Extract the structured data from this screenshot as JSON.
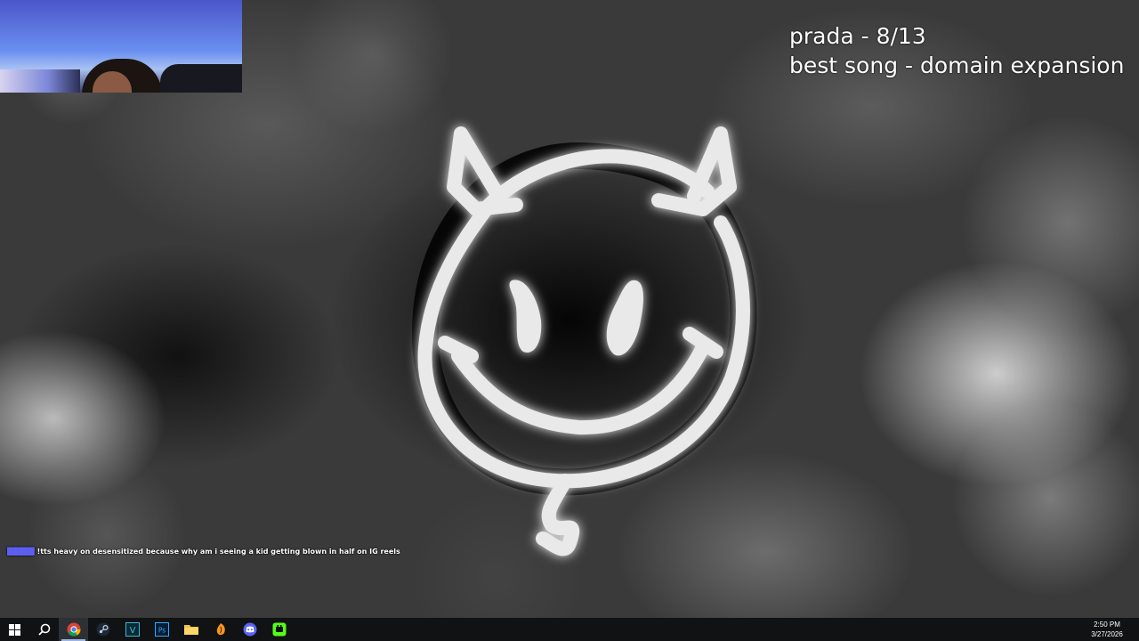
{
  "overlay": {
    "line1": "prada - 8/13",
    "line2": "best song - domain expansion"
  },
  "chat": {
    "username": "█████",
    "message": "!tts heavy on desensitized because why am i seeing a kid getting blown in half on IG reels"
  },
  "taskbar": {
    "apps": [
      {
        "name": "windows-start",
        "icon": "windows-icon"
      },
      {
        "name": "search",
        "icon": "search-icon"
      },
      {
        "name": "chrome",
        "icon": "chrome-icon",
        "active": true
      },
      {
        "name": "steam",
        "icon": "steam-icon"
      },
      {
        "name": "vegas",
        "icon": "vegas-icon"
      },
      {
        "name": "photoshop",
        "icon": "photoshop-icon"
      },
      {
        "name": "file-explorer",
        "icon": "folder-icon"
      },
      {
        "name": "fl-studio",
        "icon": "fl-studio-icon"
      },
      {
        "name": "discord",
        "icon": "discord-icon"
      },
      {
        "name": "streaming-app",
        "icon": "stream-app-icon"
      }
    ],
    "time": "2:50 PM",
    "date": "3/27/2026"
  },
  "colors": {
    "taskbar_bg": "#101214",
    "chat_username": "#5d5ff0",
    "overlay_text": "#ffffff"
  }
}
